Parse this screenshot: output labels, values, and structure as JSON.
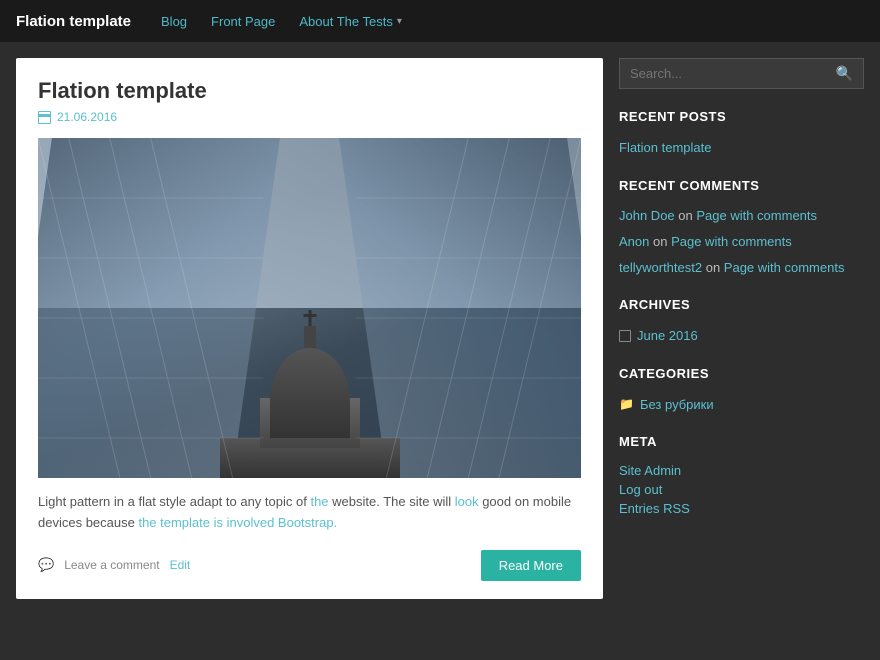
{
  "nav": {
    "brand": "Flation template",
    "links": [
      {
        "label": "Blog",
        "href": "#",
        "dropdown": false
      },
      {
        "label": "Front Page",
        "href": "#",
        "dropdown": false
      },
      {
        "label": "About The Tests",
        "href": "#",
        "dropdown": true
      }
    ]
  },
  "post": {
    "title": "Flation template",
    "date": "21.06.2016",
    "excerpt": "Light pattern in a flat style adapt to any topic of the website. The site will look good on mobile devices because the template is involved Bootstrap.",
    "read_more_label": "Read More",
    "leave_comment_label": "Leave a comment",
    "edit_label": "Edit"
  },
  "sidebar": {
    "search_placeholder": "Search...",
    "recent_posts_title": "RECENT POSTS",
    "recent_posts": [
      {
        "label": "Flation template",
        "href": "#"
      }
    ],
    "recent_comments_title": "RECENT COMMENTS",
    "recent_comments": [
      {
        "author": "John Doe",
        "on": "on",
        "page": "Page with comments"
      },
      {
        "author": "Anon",
        "on": "on",
        "page": "Page with comments"
      },
      {
        "author": "tellyworthtest2",
        "on": "on",
        "page": "Page with comments"
      }
    ],
    "archives_title": "ARCHIVES",
    "archives": [
      {
        "label": "June 2016",
        "href": "#"
      }
    ],
    "categories_title": "CATEGORIES",
    "categories": [
      {
        "label": "Без рубрики",
        "href": "#"
      }
    ],
    "meta_title": "META",
    "meta_links": [
      {
        "label": "Site Admin",
        "href": "#"
      },
      {
        "label": "Log out",
        "href": "#"
      },
      {
        "label": "Entries RSS",
        "href": "#"
      }
    ]
  }
}
